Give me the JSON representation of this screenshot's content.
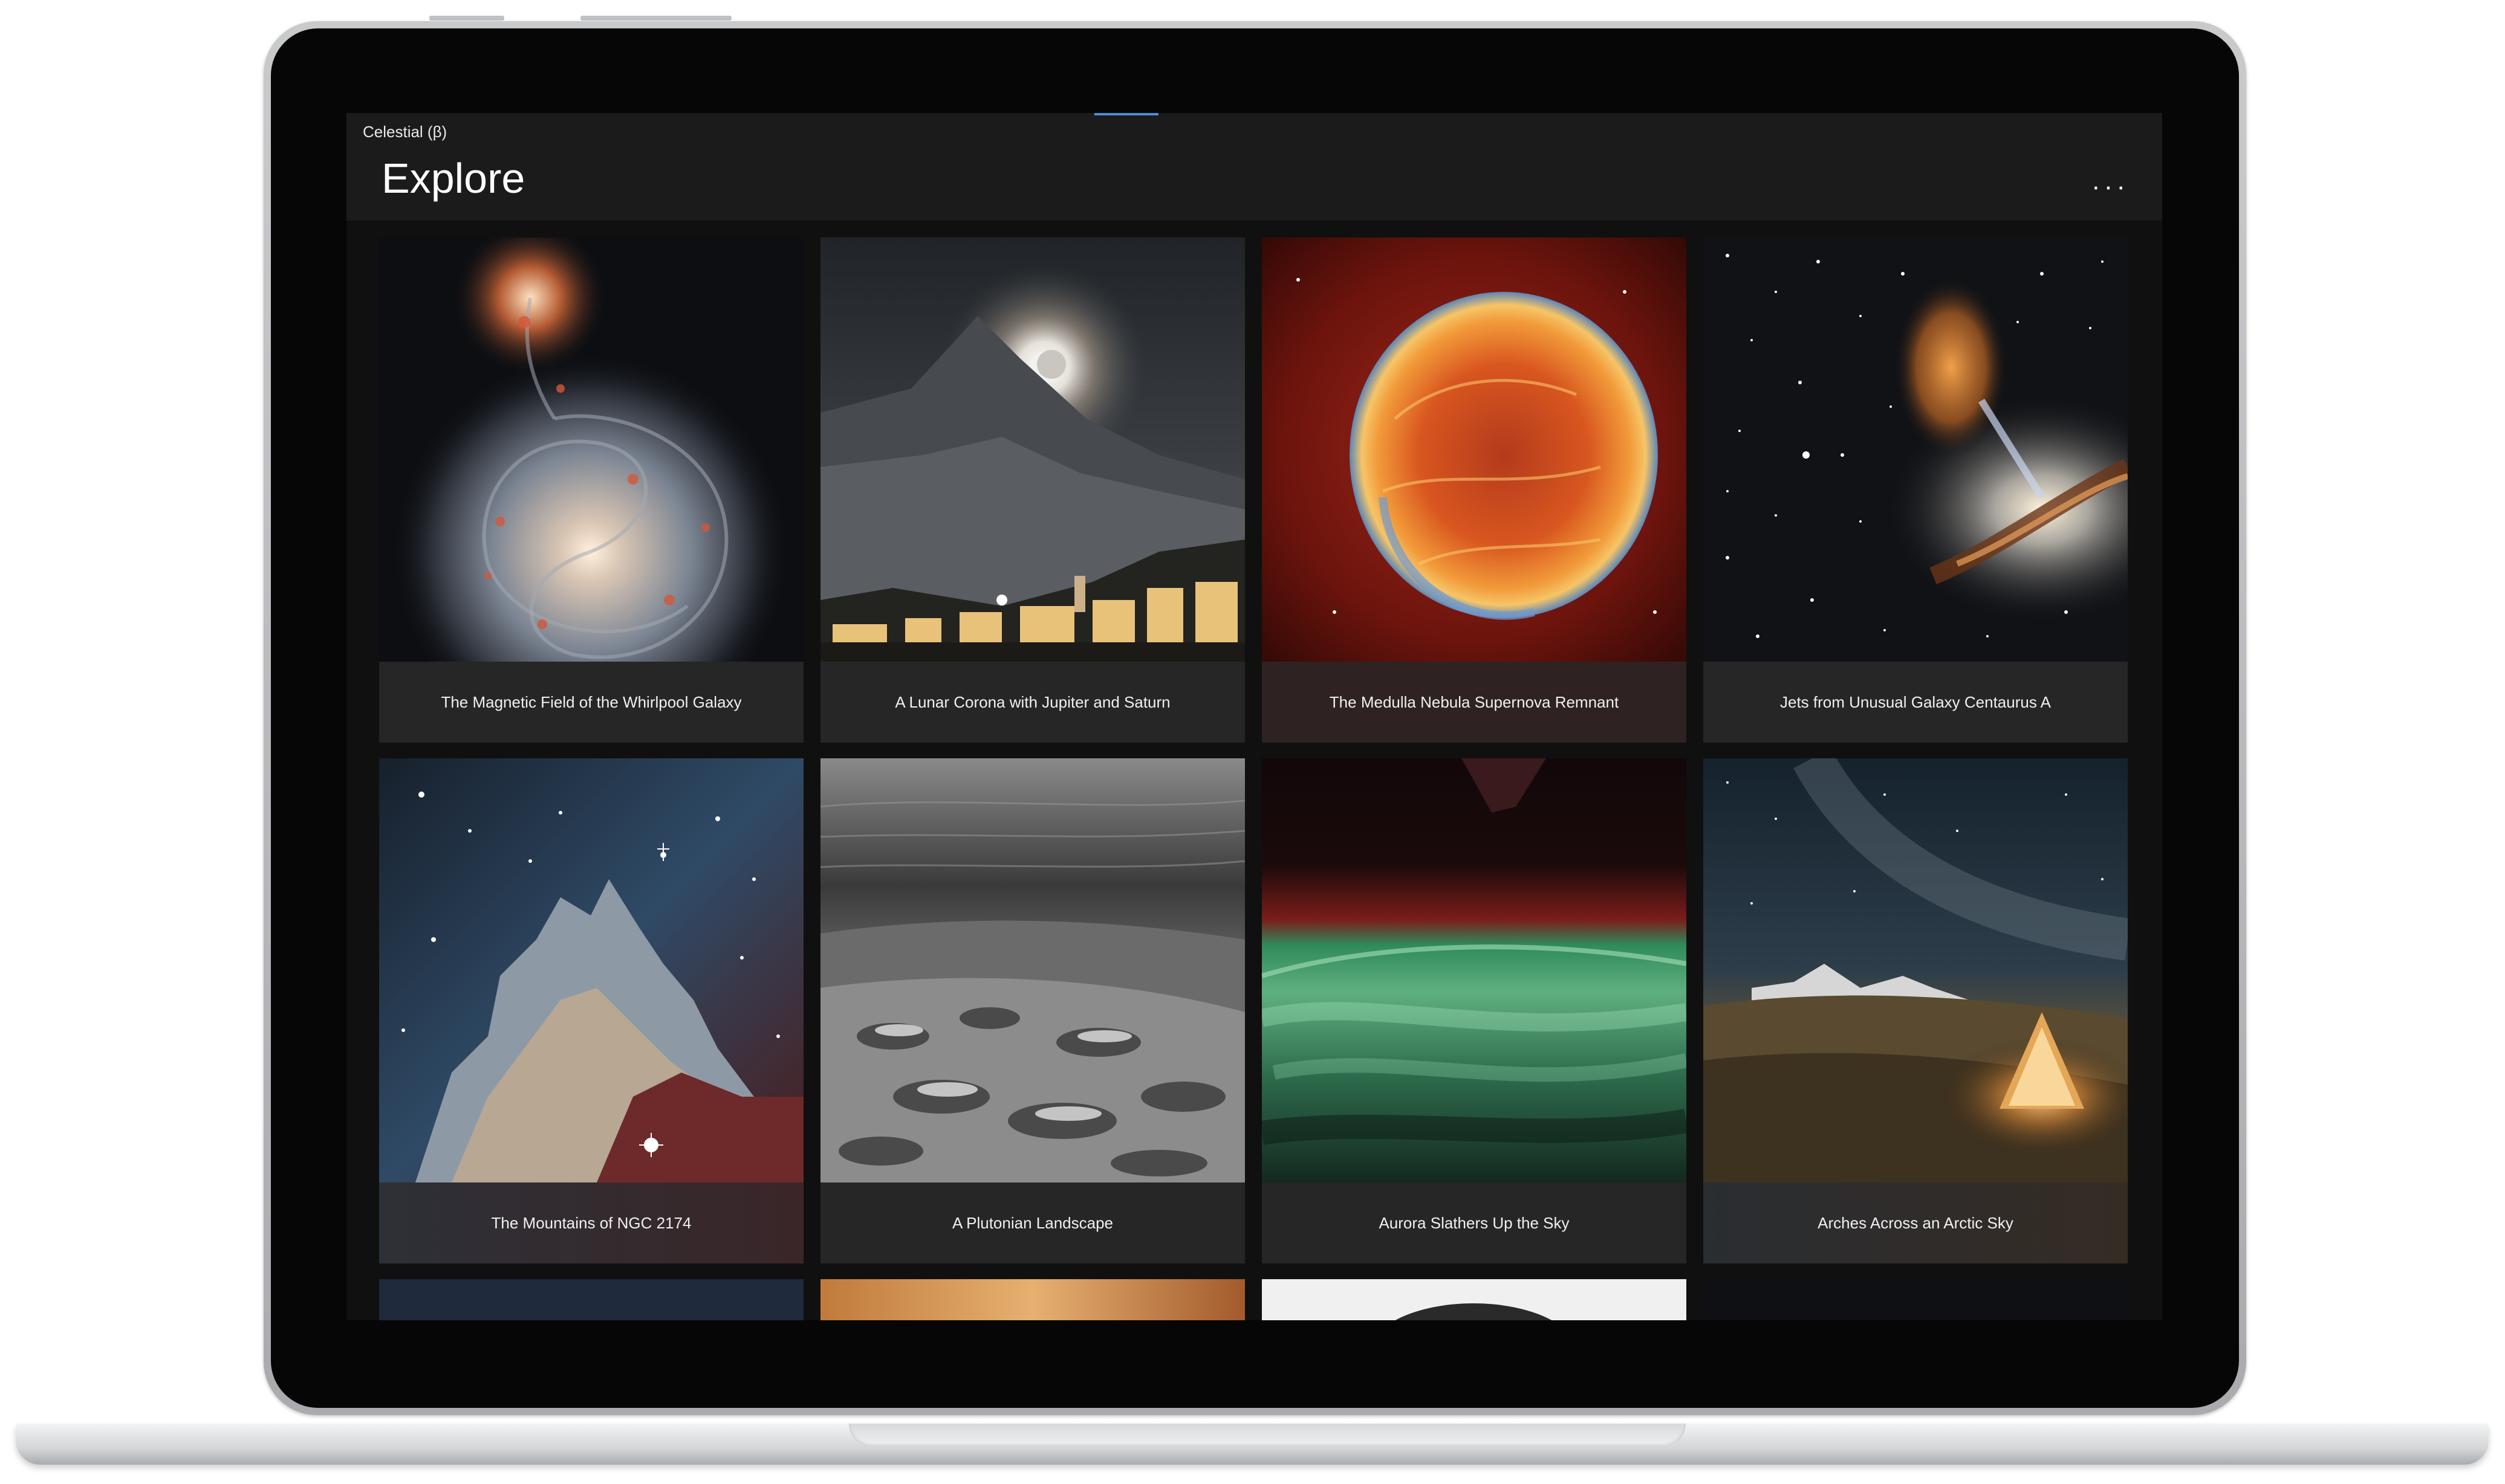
{
  "app": {
    "name": "Celestial (β)",
    "page_title": "Explore",
    "more_label": "···"
  },
  "gallery": {
    "items": [
      {
        "title": "The Magnetic Field of the Whirlpool Galaxy"
      },
      {
        "title": "A Lunar Corona with Jupiter and Saturn"
      },
      {
        "title": "The Medulla Nebula Supernova Remnant"
      },
      {
        "title": "Jets from Unusual Galaxy Centaurus A"
      },
      {
        "title": "The Mountains of NGC 2174"
      },
      {
        "title": "A Plutonian Landscape"
      },
      {
        "title": "Aurora Slathers Up the Sky"
      },
      {
        "title": "Arches Across an Arctic Sky"
      }
    ]
  },
  "colors": {
    "screen_background": "#101010",
    "titlebar": "#1b1b1b",
    "card_caption": "#262626",
    "accent": "#4a8fd4"
  }
}
